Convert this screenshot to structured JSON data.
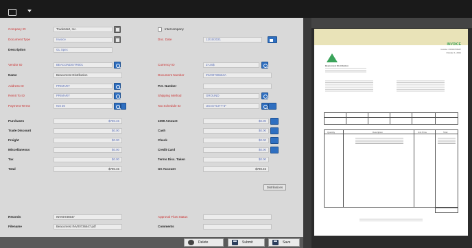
{
  "form": {
    "left": {
      "company_id": {
        "label": "Company ID",
        "value": "TradeMart, Inc."
      },
      "document_type": {
        "label": "Document Type",
        "value": "Invoice"
      },
      "description": {
        "label": "Description",
        "value": "GL Spec"
      },
      "vendor_id": {
        "label": "Vendor ID",
        "value": "BEACONDISTR001"
      },
      "name": {
        "label": "Name",
        "value": "Beaconrest Distribution"
      },
      "address_id": {
        "label": "Address ID",
        "value": "PRIMARY"
      },
      "remit_to_id": {
        "label": "Remit To ID",
        "value": "PRIMARY"
      },
      "payment_terms": {
        "label": "Payment Terms",
        "value": "Net 30"
      }
    },
    "right": {
      "inter_company_label": "Intercompany",
      "doc_date": {
        "label": "Doc. Date",
        "value": "12/15/2021"
      },
      "currency_id": {
        "label": "Currency ID",
        "value": "Z-US$"
      },
      "document_number": {
        "label": "Document Number",
        "value": "INV00736664A"
      },
      "po_number": {
        "label": "P.O. Number",
        "value": ""
      },
      "shipping_method": {
        "label": "Shipping Method",
        "value": "GROUND"
      },
      "tax_schedule_id": {
        "label": "Tax Schedule ID",
        "value": "USASTCITY-6*"
      }
    },
    "amounts_left": [
      {
        "label": "Purchases",
        "value": "$780.45"
      },
      {
        "label": "Trade Discount",
        "value": "$0.00"
      },
      {
        "label": "Freight",
        "value": "$0.00"
      },
      {
        "label": "Miscellaneous",
        "value": "$0.00"
      },
      {
        "label": "Tax",
        "value": "$0.00"
      },
      {
        "label": "Total",
        "value": "$780.45"
      }
    ],
    "amounts_right": [
      {
        "label": "1099 Amount",
        "value": "$0.00"
      },
      {
        "label": "Cash",
        "value": "$0.00"
      },
      {
        "label": "Check",
        "value": "$0.00"
      },
      {
        "label": "Credit Card",
        "value": "$0.00"
      },
      {
        "label": "Terms Disc. Taken",
        "value": "$0.00"
      },
      {
        "label": "On Account",
        "value": "$780.45"
      }
    ],
    "distributions_button": "Distributions",
    "records": {
      "label": "Records",
      "value": "INV00736647"
    },
    "filename": {
      "label": "Filename",
      "value": "Beaconrest INV00736647.pdf"
    },
    "approval_flow": {
      "label": "Approval Flow Status",
      "value": ""
    },
    "comments": {
      "label": "Comments",
      "value": ""
    },
    "footer": {
      "delete": "Delete",
      "submit": "Submit",
      "save": "Save"
    }
  },
  "invoice": {
    "heading": "INVOICE",
    "invoice_no": "Invoice: INV00736647",
    "invoice_date": "October 1, 2021",
    "from_name": "Beaconrest Distribution",
    "table_headers": [
      "Quantity",
      "Description",
      "Unit Price",
      "Total"
    ],
    "colors": {
      "accent": "#3aa35a",
      "paper_band": "#e9e3b8"
    }
  },
  "colors": {
    "form_bg": "#d9d9d9",
    "required_label": "#c33333",
    "button_blue": "#2f6fc0"
  }
}
